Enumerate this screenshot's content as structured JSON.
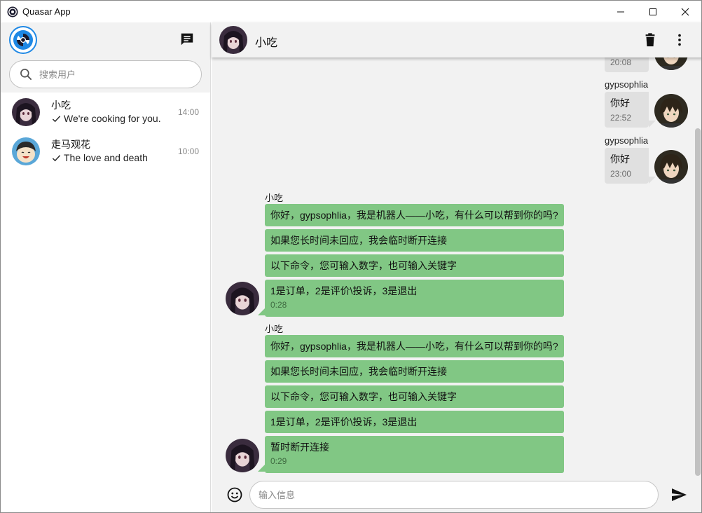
{
  "window": {
    "title": "Quasar App"
  },
  "sidebar": {
    "search": {
      "placeholder": "搜索用户"
    },
    "conversations": [
      {
        "name": "小吃",
        "preview": "We're cooking for you.",
        "time": "14:00"
      },
      {
        "name": "走马观花",
        "preview": "The love and death",
        "time": "10:00"
      }
    ]
  },
  "chat": {
    "header": {
      "name": "小吃"
    },
    "partial_top": {
      "time": "20:08"
    },
    "sent": [
      {
        "sender": "gypsophlia",
        "text": "你好",
        "time": "22:52"
      },
      {
        "sender": "gypsophlia",
        "text": "你好",
        "time": "23:00"
      }
    ],
    "received": [
      {
        "sender": "小吃",
        "lines": [
          "你好，gypsophlia，我是机器人——小吃，有什么可以帮到你的吗?",
          "如果您长时间未回应，我会临时断开连接",
          "以下命令，您可输入数字，也可输入关键字",
          "1是订单，2是评价\\投诉，3是退出"
        ],
        "time": "0:28"
      },
      {
        "sender": "小吃",
        "lines": [
          "你好，gypsophlia，我是机器人——小吃，有什么可以帮到你的吗?",
          "如果您长时间未回应，我会临时断开连接",
          "以下命令，您可输入数字，也可输入关键字",
          "1是订单，2是评价\\投诉，3是退出",
          "暂时断开连接"
        ],
        "time": "0:29"
      }
    ],
    "composer": {
      "placeholder": "输入信息"
    }
  },
  "colors": {
    "bot_bubble": "#81c784",
    "user_bubble": "#e0e0e0",
    "header_bg": "#f2f2f2",
    "app_icon": "#1e88e5"
  },
  "icons": {
    "app": "quasar-logo-icon",
    "compose": "chat-bubble-icon",
    "search": "search-icon",
    "delivered": "check-icon",
    "delete": "trash-icon",
    "more": "more-vert-icon",
    "emoji": "smiley-icon",
    "send": "send-icon"
  }
}
